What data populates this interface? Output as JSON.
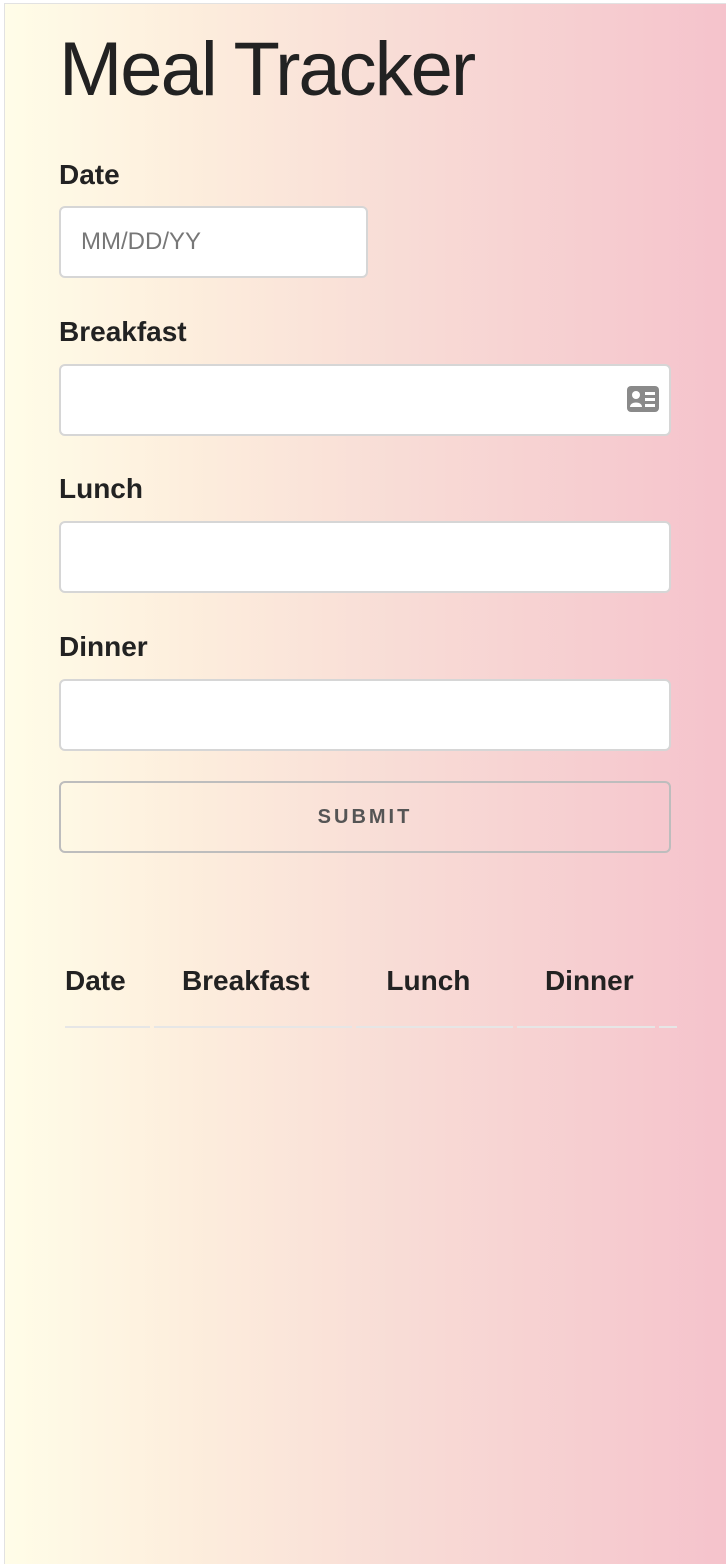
{
  "app": {
    "title": "Meal Tracker"
  },
  "form": {
    "date": {
      "label": "Date",
      "value": "",
      "placeholder": "MM/DD/YY"
    },
    "breakfast": {
      "label": "Breakfast",
      "value": "",
      "placeholder": "",
      "icon": "contact-card-icon"
    },
    "lunch": {
      "label": "Lunch",
      "value": "",
      "placeholder": ""
    },
    "dinner": {
      "label": "Dinner",
      "value": "",
      "placeholder": ""
    },
    "submit_label": "Submit"
  },
  "table": {
    "headers": [
      "Date",
      "Breakfast",
      "Lunch",
      "Dinner",
      ""
    ],
    "rows": []
  },
  "colors": {
    "gradient_start": "#fffde8",
    "gradient_end": "#f5c3cc",
    "text": "#222222",
    "input_border": "#d6d6d6"
  }
}
